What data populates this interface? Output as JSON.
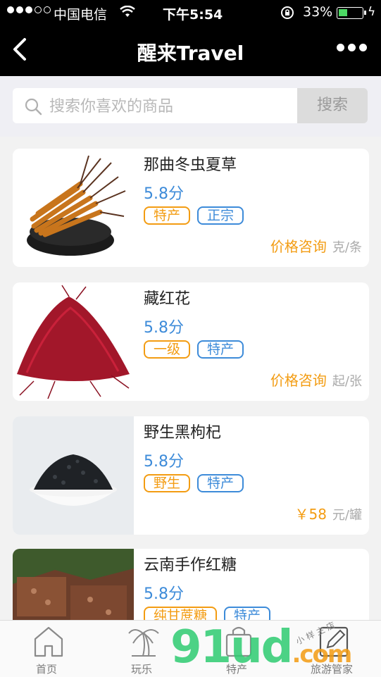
{
  "status": {
    "carrier": "中国电信",
    "time": "下午5:54",
    "battery": "33%"
  },
  "navbar": {
    "title": "醒来Travel"
  },
  "search": {
    "placeholder": "搜索你喜欢的商品",
    "button": "搜索"
  },
  "products": [
    {
      "name": "那曲冬虫夏草",
      "score": "5.8分",
      "tags": [
        "特产",
        "正宗"
      ],
      "price": "价格咨询",
      "unit": "克/条"
    },
    {
      "name": "藏红花",
      "score": "5.8分",
      "tags": [
        "一级",
        "特产"
      ],
      "price": "价格咨询",
      "unit": "起/张"
    },
    {
      "name": "野生黑枸杞",
      "score": "5.8分",
      "tags": [
        "野生",
        "特产"
      ],
      "price": "￥58",
      "unit": "元/罐"
    },
    {
      "name": "云南手作红糖",
      "score": "5.8分",
      "tags": [
        "纯甘蔗糖",
        "特产"
      ],
      "price": "",
      "unit": ""
    }
  ],
  "tabs": [
    {
      "label": "首页"
    },
    {
      "label": "玩乐"
    },
    {
      "label": "特产"
    },
    {
      "label": "旅游管家"
    }
  ],
  "watermark": {
    "main": "91ud",
    "suffix": ".com",
    "small": "小 样 主 店"
  },
  "colors": {
    "accent_orange": "#f39c12",
    "accent_blue": "#3d8bd9",
    "bar_black": "#000000"
  }
}
